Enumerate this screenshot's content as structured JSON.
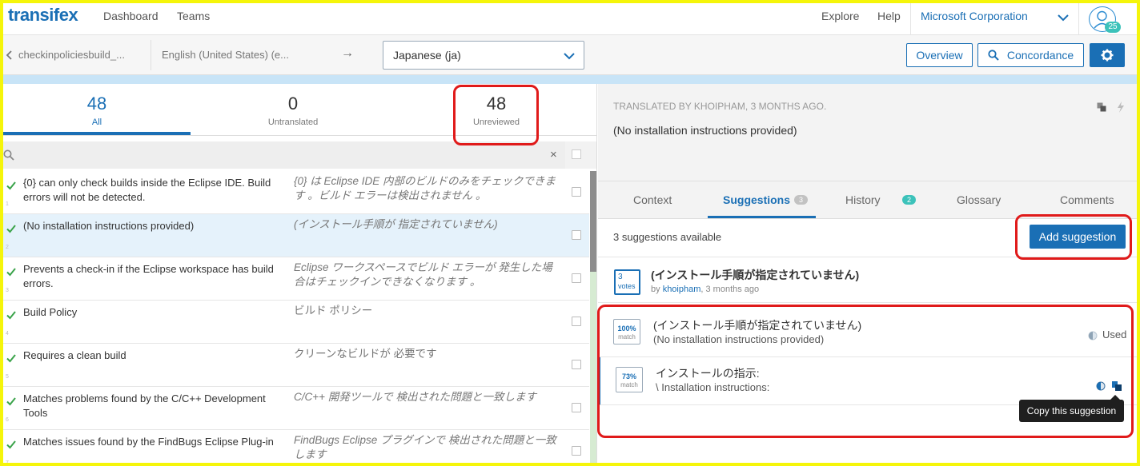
{
  "app": {
    "logo": "transifex"
  },
  "nav": {
    "dashboard": "Dashboard",
    "teams": "Teams",
    "explore": "Explore",
    "help": "Help",
    "organization": "Microsoft Corporation",
    "avatar_badge": "25"
  },
  "toolbar": {
    "project": "checkinpoliciesbuild_...",
    "source_language": "English (United States) (e...",
    "arrow": "→",
    "target_language": "Japanese (ja)",
    "overview": "Overview",
    "concordance": "Concordance"
  },
  "stats": [
    {
      "count": "48",
      "label": "All"
    },
    {
      "count": "0",
      "label": "Untranslated"
    },
    {
      "count": "48",
      "label": "Unreviewed"
    }
  ],
  "search": {
    "clear": "×"
  },
  "strings": [
    {
      "index": "1",
      "source": "{0} can only check builds inside the Eclipse IDE. Build errors will not be detected.",
      "target": "{0} は Eclipse IDE 内部のビルドのみをチェックできます 。ビルド エラーは検出されません 。"
    },
    {
      "index": "2",
      "source": "(No installation instructions provided)",
      "target": "(インストール手順が 指定されていません)"
    },
    {
      "index": "3",
      "source": "Prevents a check-in if the Eclipse workspace has build errors.",
      "target": "Eclipse ワークスペースでビルド エラーが 発生した場合はチェックインできなくなります 。"
    },
    {
      "index": "4",
      "source": "Build Policy",
      "target": "ビルド ポリシー"
    },
    {
      "index": "5",
      "source": "Requires a clean build",
      "target": "クリーンなビルドが 必要です"
    },
    {
      "index": "6",
      "source": "Matches problems found by the C/C++ Development Tools",
      "target": "C/C++ 開発ツールで 検出された問題と一致します"
    },
    {
      "index": "7",
      "source": "Matches issues found by the FindBugs Eclipse Plug-in",
      "target": "FindBugs Eclipse プラグインで 検出された問題と一致します"
    }
  ],
  "translation": {
    "meta": "TRANSLATED BY KHOIPHAM, 3 MONTHS AGO.",
    "text": "(No installation instructions provided)"
  },
  "tabs": [
    {
      "label": "Context"
    },
    {
      "label": "Suggestions",
      "badge": "3"
    },
    {
      "label": "History",
      "badge": "2"
    },
    {
      "label": "Glossary"
    },
    {
      "label": "Comments"
    }
  ],
  "suggestions": {
    "count_text": "3 suggestions available",
    "add_button": "Add suggestion",
    "vote_item": {
      "votes": "3",
      "votes_label": "votes",
      "text": "(インストール手順が指定されていません)",
      "by": "by",
      "user": "khoipham",
      "time": ", 3 months ago"
    },
    "tm_items": [
      {
        "percent": "100%",
        "match_label": "match",
        "target": "(インストール手順が指定されていません)",
        "source": "(No installation instructions provided)",
        "status": "Used"
      },
      {
        "percent": "73%",
        "match_label": "match",
        "target": "インストールの指示:",
        "source": "\\ Installation instructions:"
      }
    ],
    "tooltip": "Copy this suggestion"
  },
  "colors": {
    "accent": "#1a6fb5",
    "annotation": "#e01a1a",
    "frame": "#f5f50a"
  }
}
